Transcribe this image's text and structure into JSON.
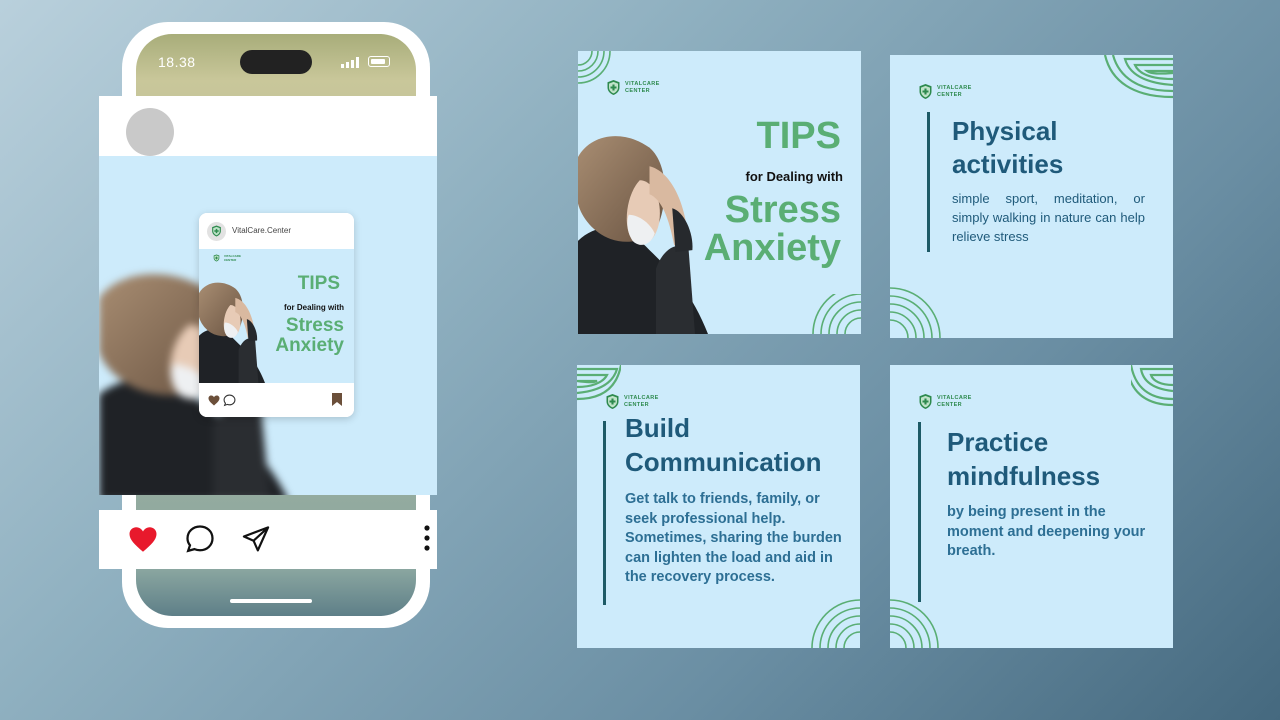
{
  "phone": {
    "status_time": "18.38"
  },
  "mini_post": {
    "account_name": "VitalCare.Center"
  },
  "brand": {
    "line1": "VITALCARE",
    "line2": "CENTER"
  },
  "cover": {
    "title": "TIPS",
    "subtitle": "for Dealing with",
    "headline_1": "Stress",
    "headline_2": "Anxiety"
  },
  "tips": [
    {
      "title_1": "Physical",
      "title_2": "activities",
      "body": "simple sport, meditation, or simply walking in nature can help relieve stress"
    },
    {
      "title_1": "Build",
      "title_2": "Communication",
      "body": "Get talk to friends, family, or seek professional help. Sometimes, sharing the burden can lighten the load and aid in the recovery process."
    },
    {
      "title_1": "Practice",
      "title_2": "mindfulness",
      "body": "by being present in the moment and deepening your breath."
    }
  ],
  "icons": [
    "signal-icon",
    "battery-icon",
    "heart-icon",
    "comment-icon",
    "send-icon",
    "more-icon",
    "bookmark-icon",
    "shield-logo-icon"
  ],
  "colors": {
    "accent_green": "#5aae74",
    "heading_blue": "#1f5a7a",
    "tile_bg": "#cdebfb",
    "like_red": "#e8192c"
  }
}
